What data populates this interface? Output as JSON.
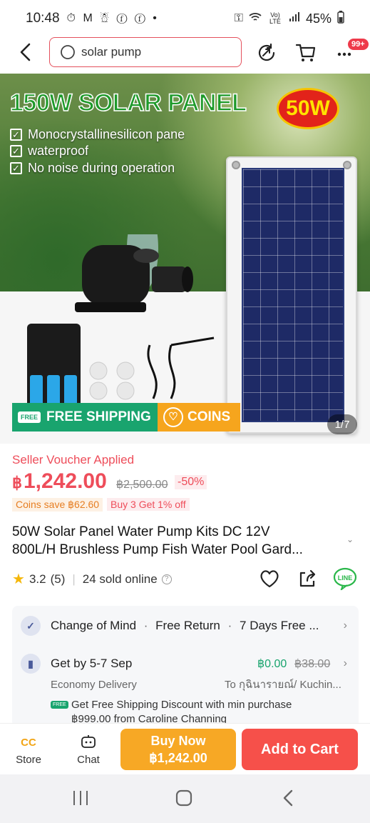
{
  "status_bar": {
    "time": "10:48",
    "icons": "⏱ M ☃ ⓕ ⓕ •",
    "network": "Vo) LTE",
    "battery": "45%"
  },
  "topbar": {
    "search_value": "solar pump",
    "cart_badge": "99+"
  },
  "hero": {
    "title": "150W SOLAR PANEL",
    "watt_badge": "50W",
    "features": [
      "Monocrystallinesilicon pane",
      "waterproof",
      "No noise during operation"
    ],
    "free_shipping": "FREE SHIPPING",
    "free_tag": "FREE",
    "coins": "COINS",
    "pager": "1/7"
  },
  "product": {
    "voucher": "Seller Voucher Applied",
    "currency": "฿",
    "price": "1,242.00",
    "original_price": "฿2,500.00",
    "discount": "-50%",
    "coins_save": "Coins save ฿62.60",
    "bundle": "Buy 3 Get 1% off",
    "title_line1": "50W Solar Panel Water Pump Kits DC 12V",
    "title_line2": "800L/H  Brushless Pump Fish Water Pool Gard...",
    "rating": "3.2",
    "reviews": "(5)",
    "sold": "24 sold online"
  },
  "info": {
    "guarantee": [
      "Change of Mind",
      "Free Return",
      "7 Days Free ..."
    ],
    "delivery_time": "Get by 5-7 Sep",
    "shipping_fee": "฿0.00",
    "shipping_orig": "฿38.00",
    "delivery_type": "Economy Delivery",
    "destination": "To กุฉินารายณ์/ Kuchin...",
    "promo_line1": "Get Free Shipping Discount with min purchase",
    "promo_line2_a": "฿999.00 from ",
    "promo_line2_b": "Caroline Channing"
  },
  "bottom_bar": {
    "store": "Store",
    "chat": "Chat",
    "buy_now": "Buy Now",
    "buy_price": "฿1,242.00",
    "add_to_cart": "Add to Cart"
  }
}
